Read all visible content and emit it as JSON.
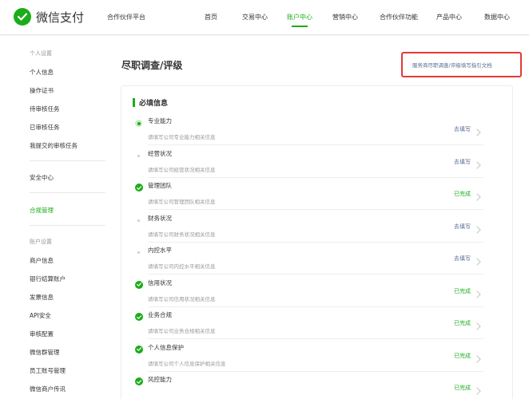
{
  "header": {
    "brand": "微信支付",
    "platform": "合作伙伴平台",
    "nav": [
      {
        "label": "首页"
      },
      {
        "label": "交易中心"
      },
      {
        "label": "账户中心"
      },
      {
        "label": "营销中心"
      },
      {
        "label": "合作伙伴功能"
      },
      {
        "label": "产品中心"
      },
      {
        "label": "数据中心"
      }
    ],
    "active_nav": "账户中心"
  },
  "sidebar": {
    "groups": [
      {
        "label": "个人设置",
        "items": [
          "个人信息",
          "操作证书",
          "待审核任务",
          "已审核任务",
          "我提交的审核任务"
        ]
      },
      {
        "label": "",
        "items": [
          "安全中心"
        ]
      },
      {
        "label": "",
        "items": [
          "合规管理"
        ]
      },
      {
        "label": "账户设置",
        "items": [
          "商户信息",
          "银行结算账户",
          "发票信息",
          "API安全",
          "审核配置",
          "微信群管理",
          "员工账号管理",
          "微信商户传讯"
        ]
      }
    ],
    "active_item": "合规管理"
  },
  "main": {
    "title": "尽职调查/评级",
    "guide_link": "服务商尽职调查/评级填写指引文档",
    "section_title": "必填信息",
    "rows": [
      {
        "title": "专业能力",
        "desc": "请填写公司专业能力相关信息",
        "action": "去填写",
        "status": "current"
      },
      {
        "title": "经营状况",
        "desc": "请填写公司经营状况相关信息",
        "action": "去填写",
        "status": "pending"
      },
      {
        "title": "管理团队",
        "desc": "请填写公司管理团队相关信息",
        "action": "已完成",
        "status": "done"
      },
      {
        "title": "财务状况",
        "desc": "请填写公司财务状况相关信息",
        "action": "去填写",
        "status": "pending"
      },
      {
        "title": "内控水平",
        "desc": "请填写公司内控水平相关信息",
        "action": "去填写",
        "status": "pending"
      },
      {
        "title": "信用状况",
        "desc": "请填写公司信用状况相关信息",
        "action": "已完成",
        "status": "done"
      },
      {
        "title": "业务合规",
        "desc": "请填写公司业务合规相关信息",
        "action": "已完成",
        "status": "done"
      },
      {
        "title": "个人信息保护",
        "desc": "请填写公司个人信息保护相关信息",
        "action": "已完成",
        "status": "done"
      },
      {
        "title": "风控能力",
        "desc": "",
        "action": "已完成",
        "status": "done"
      }
    ]
  },
  "colors": {
    "accent": "#1aad19",
    "link": "#576b95",
    "highlight_border": "#e53935"
  },
  "icons": {
    "logo": "wechat-pay-logo-icon",
    "done": "check-circle-icon",
    "current": "current-step-icon",
    "pending": "pending-dot-icon",
    "chevron": "chevron-right-icon"
  }
}
